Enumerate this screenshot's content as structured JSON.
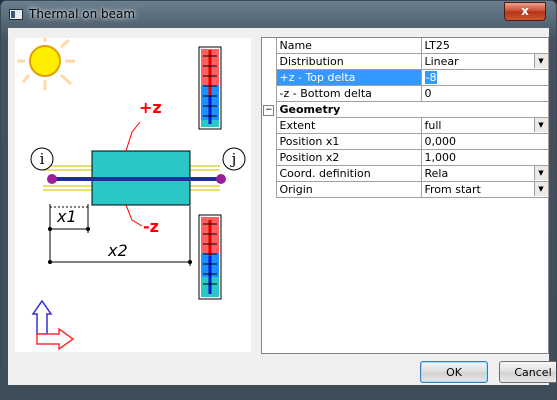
{
  "window": {
    "title": "Thermal on beam",
    "close_label": "x"
  },
  "diagram": {
    "labels": {
      "plus_z": "+z",
      "minus_z": "-z",
      "node_i": "i",
      "node_j": "j",
      "x1": "x1",
      "x2": "x2"
    }
  },
  "properties": {
    "rows": [
      {
        "name": "Name",
        "value": "LT25",
        "dropdown": false
      },
      {
        "name": "Distribution",
        "value": "Linear",
        "dropdown": true
      },
      {
        "name": "+z - Top delta",
        "value": "-8",
        "dropdown": false,
        "selected": true
      },
      {
        "name": "-z - Bottom delta",
        "value": "0",
        "dropdown": false
      }
    ],
    "category": {
      "name": "Geometry",
      "toggle": "−"
    },
    "geometry_rows": [
      {
        "name": "Extent",
        "value": "full",
        "dropdown": true
      },
      {
        "name": "Position x1",
        "value": "0,000",
        "dropdown": false
      },
      {
        "name": "Position x2",
        "value": "1,000",
        "dropdown": false
      },
      {
        "name": "Coord. definition",
        "value": "Rela",
        "dropdown": true
      },
      {
        "name": "Origin",
        "value": "From start",
        "dropdown": true
      }
    ]
  },
  "buttons": {
    "ok": "OK",
    "cancel": "Cancel"
  },
  "colors": {
    "accent_selection": "#3399ff",
    "beam": "#2bc7c7",
    "heat": "#ff0000",
    "cold": "#1e90ff"
  }
}
